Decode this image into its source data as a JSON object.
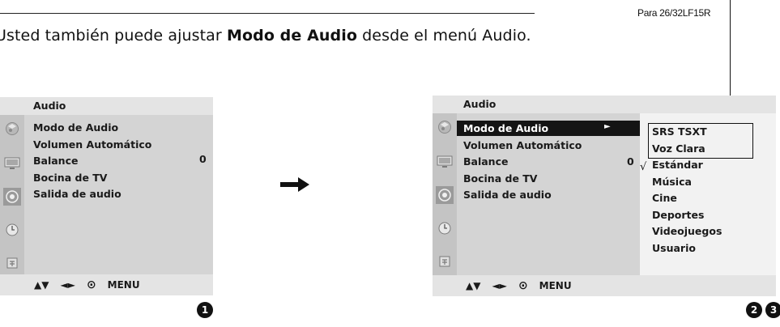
{
  "intro": {
    "pre": "Usted también puede ajustar ",
    "bold": "Modo de Audio",
    "mid": " desde el menú ",
    "menu_name": "Audio",
    "post": "."
  },
  "model_note": "Para 26/32LF15R",
  "menu1": {
    "title": "Audio",
    "items": [
      "Modo de Audio",
      "Volumen Automático",
      "Balance",
      "Bocina de TV",
      "Salida de audio"
    ],
    "balance_value": "0",
    "footer": {
      "arrows_ud": "▲▼",
      "arrows_lr": "◄►",
      "ok": "⊙",
      "menu": "MENU"
    },
    "icons": [
      "picture-icon",
      "screen-icon",
      "audio-icon",
      "clock-icon",
      "lock-icon"
    ],
    "selected_icon": 2
  },
  "menu2": {
    "title": "Audio",
    "items": [
      "Modo de Audio",
      "Volumen Automático",
      "Balance",
      "Bocina de TV",
      "Salida de audio"
    ],
    "highlighted_item": "Modo de Audio",
    "submenu_arrow": "►",
    "balance_value": "0",
    "submenu": [
      "SRS TSXT",
      "Voz Clara",
      "Estándar",
      "Música",
      "Cine",
      "Deportes",
      "Videojuegos",
      "Usuario"
    ],
    "checked_option": "Estándar",
    "check_mark": "√",
    "footer": {
      "arrows_ud": "▲▼",
      "arrows_lr": "◄►",
      "ok": "⊙",
      "menu": "MENU"
    }
  },
  "step_numbers": [
    "1",
    "2",
    "3"
  ],
  "colors": {
    "panel": "#d4d4d4",
    "title_bar": "#e4e4e4",
    "icon_column": "#c4c4c4",
    "highlight": "#141414",
    "submenu": "#f2f2f2"
  }
}
